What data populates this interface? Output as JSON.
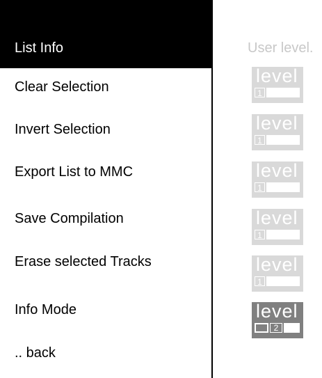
{
  "menu": {
    "header": "List Info",
    "items": [
      {
        "label": "Clear Selection",
        "level": "1"
      },
      {
        "label": "Invert Selection",
        "level": "1"
      },
      {
        "label": "Export List to MMC",
        "level": "1"
      },
      {
        "label": "Save Compilation",
        "level": "1"
      },
      {
        "label": "Erase selected Tracks",
        "level": "1"
      },
      {
        "label": "Info Mode",
        "level": "2"
      },
      {
        "label": ".. back"
      }
    ]
  },
  "level_column": {
    "header": "User level.",
    "badge_word": "level"
  },
  "colors": {
    "header_bg": "#000000",
    "inactive_badge": "#d9d9d9",
    "active_badge": "#808080",
    "muted_text": "#c8c8c8"
  }
}
